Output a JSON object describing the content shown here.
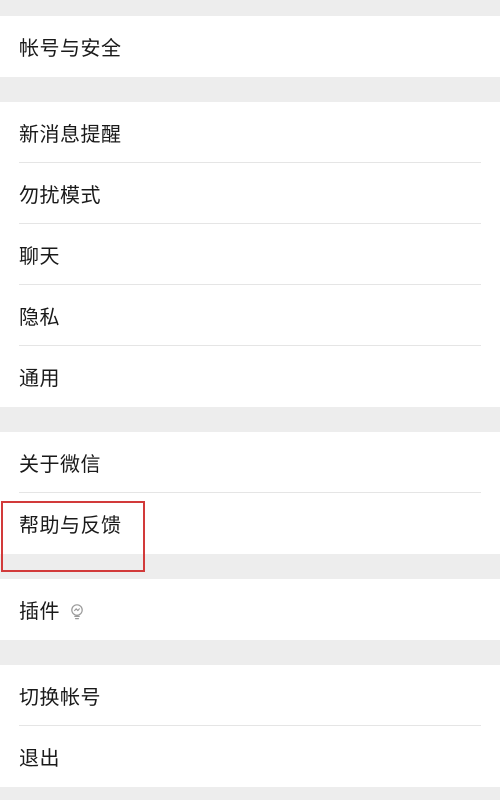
{
  "sections": {
    "account": {
      "items": [
        {
          "label": "帐号与安全"
        }
      ]
    },
    "settings": {
      "items": [
        {
          "label": "新消息提醒"
        },
        {
          "label": "勿扰模式"
        },
        {
          "label": "聊天"
        },
        {
          "label": "隐私"
        },
        {
          "label": "通用"
        }
      ]
    },
    "about": {
      "items": [
        {
          "label": "关于微信"
        },
        {
          "label": "帮助与反馈"
        }
      ]
    },
    "plugins": {
      "items": [
        {
          "label": "插件",
          "icon": "plugin-bulb-icon"
        }
      ]
    },
    "session": {
      "items": [
        {
          "label": "切换帐号"
        },
        {
          "label": "退出"
        }
      ]
    }
  },
  "highlight": {
    "target": "帮助与反馈",
    "color": "#d23a3a"
  },
  "colors": {
    "background": "#ededed",
    "card": "#ffffff",
    "text": "#1a1a1a",
    "divider": "#e5e5e5"
  }
}
